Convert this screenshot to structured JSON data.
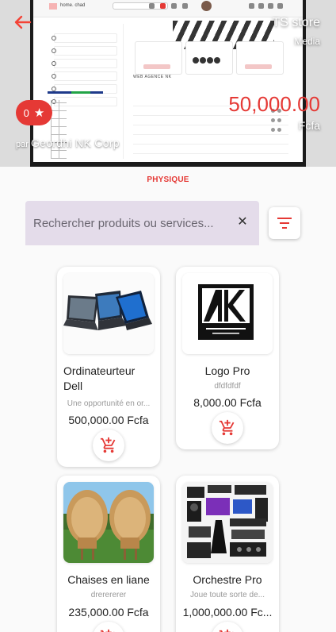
{
  "header": {
    "store_name": "TS store",
    "store_type": "Media",
    "rating": "0",
    "owner_prefix": "par",
    "owner_name": "Geordhi NK Corp",
    "price": "50,000.00",
    "currency": "Fcfa",
    "screenshot_web_label": "WEB AGENCE NK"
  },
  "category": "PHYSIQUE",
  "search": {
    "placeholder": "Rechercher produits ou services...",
    "value": ""
  },
  "icons": {
    "back": "arrow-left-icon",
    "rating": "star-icon",
    "clear": "close-icon",
    "filter": "filter-list-icon",
    "cart": "add-shopping-cart-icon"
  },
  "colors": {
    "accent": "#e53935",
    "search_bg": "#e4dcea",
    "card_bg": "#ffffff"
  },
  "products": [
    {
      "name": "Ordinateurteur Dell",
      "description": "Une opportunité en or...",
      "price": "500,000.00 Fcfa"
    },
    {
      "name": "Logo Pro",
      "description": "dfdfdfdf",
      "price": "8,000.00 Fcfa"
    },
    {
      "name": "Chaises en liane",
      "description": "drerererer",
      "price": "235,000.00 Fcfa"
    },
    {
      "name": "Orchestre Pro",
      "description": "Joue toute sorte de...",
      "price": "1,000,000.00 Fc..."
    }
  ]
}
